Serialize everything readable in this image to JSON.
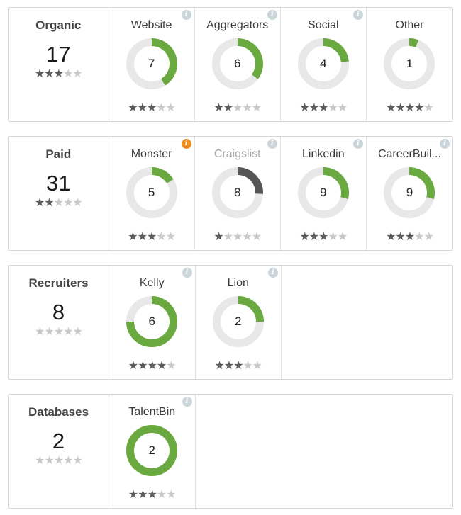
{
  "colors": {
    "accent": "#6aa940",
    "inactive": "#555555",
    "track": "#e8e8e8",
    "info": "#cbd5dc",
    "warning": "#f28c1b"
  },
  "groups": [
    {
      "title": "Organic",
      "total": "17",
      "rating": 3,
      "sources": [
        {
          "name": "Website",
          "value": "7",
          "fraction": 0.412,
          "rating": 3,
          "info": "normal",
          "active": true
        },
        {
          "name": "Aggregators",
          "value": "6",
          "fraction": 0.353,
          "rating": 2,
          "info": "normal",
          "active": true
        },
        {
          "name": "Social",
          "value": "4",
          "fraction": 0.235,
          "rating": 3,
          "info": "normal",
          "active": true
        },
        {
          "name": "Other",
          "value": "1",
          "fraction": 0.059,
          "rating": 4,
          "info": "none",
          "active": true
        }
      ]
    },
    {
      "title": "Paid",
      "total": "31",
      "rating": 2,
      "sources": [
        {
          "name": "Monster",
          "value": "5",
          "fraction": 0.161,
          "rating": 3,
          "info": "warning",
          "active": true
        },
        {
          "name": "Craigslist",
          "value": "8",
          "fraction": 0.258,
          "rating": 1,
          "info": "normal",
          "active": false
        },
        {
          "name": "Linkedin",
          "value": "9",
          "fraction": 0.29,
          "rating": 3,
          "info": "normal",
          "active": true
        },
        {
          "name": "CareerBuil...",
          "value": "9",
          "fraction": 0.29,
          "rating": 3,
          "info": "normal",
          "active": true
        }
      ]
    },
    {
      "title": "Recruiters",
      "total": "8",
      "rating": 0,
      "sources": [
        {
          "name": "Kelly",
          "value": "6",
          "fraction": 0.75,
          "rating": 4,
          "info": "normal",
          "active": true
        },
        {
          "name": "Lion",
          "value": "2",
          "fraction": 0.25,
          "rating": 3,
          "info": "normal",
          "active": true
        }
      ]
    },
    {
      "title": "Databases",
      "total": "2",
      "rating": 0,
      "sources": [
        {
          "name": "TalentBin",
          "value": "2",
          "fraction": 1.0,
          "rating": 3,
          "info": "normal",
          "active": true
        }
      ]
    }
  ]
}
